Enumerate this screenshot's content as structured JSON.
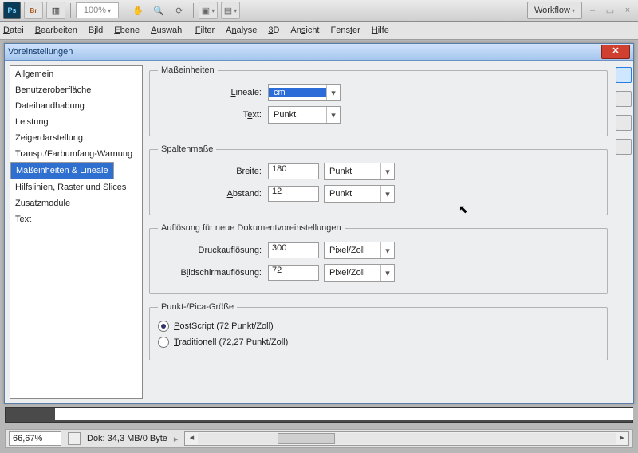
{
  "app": {
    "logo_text": "Ps",
    "zoom": "100%",
    "workflow_label": "Workflow",
    "window_min": "–",
    "window_restore": "▭",
    "window_close": "×"
  },
  "menu": [
    "Datei",
    "Bearbeiten",
    "Bild",
    "Ebene",
    "Auswahl",
    "Filter",
    "Analyse",
    "3D",
    "Ansicht",
    "Fenster",
    "Hilfe"
  ],
  "dialog": {
    "title": "Voreinstellungen",
    "close_glyph": "✕"
  },
  "sidebar": {
    "items": [
      "Allgemein",
      "Benutzeroberfläche",
      "Dateihandhabung",
      "Leistung",
      "Zeigerdarstellung",
      "Transp./Farbumfang-Warnung",
      "Maßeinheiten & Lineale",
      "Hilfslinien, Raster und Slices",
      "Zusatzmodule",
      "Text"
    ],
    "selected_index": 6
  },
  "groups": {
    "units": {
      "legend": "Maßeinheiten",
      "rulers_label": "Lineale:",
      "rulers_value": "cm",
      "text_label": "Text:",
      "text_value": "Punkt"
    },
    "columns": {
      "legend": "Spaltenmaße",
      "width_label": "Breite:",
      "width_value": "180",
      "width_unit": "Punkt",
      "gutter_label": "Abstand:",
      "gutter_value": "12",
      "gutter_unit": "Punkt"
    },
    "resolution": {
      "legend": "Auflösung für neue Dokumentvoreinstellungen",
      "print_label": "Druckauflösung:",
      "print_value": "300",
      "print_unit": "Pixel/Zoll",
      "screen_label": "Bildschirmauflösung:",
      "screen_value": "72",
      "screen_unit": "Pixel/Zoll"
    },
    "pointpica": {
      "legend": "Punkt-/Pica-Größe",
      "postscript_label": "PostScript (72 Punkt/Zoll)",
      "traditional_label": "Traditionell (72,27 Punkt/Zoll)"
    }
  },
  "statusbar": {
    "zoom": "66,67%",
    "doc": "Dok: 34,3 MB/0 Byte",
    "thumb_label": "…",
    "hscroll_left": "◂",
    "hscroll_right": "▸"
  },
  "icons": {
    "bridge": "Br",
    "hand": "✋",
    "magnify": "🔍",
    "rotate": "⟳",
    "screenA": "▣",
    "screenB": "▤",
    "tri": "▾",
    "pointer": "⬉"
  }
}
